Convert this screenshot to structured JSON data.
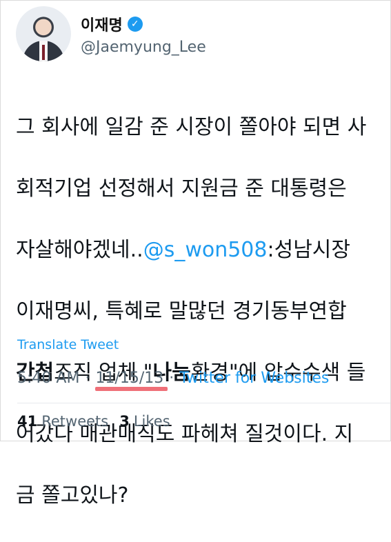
{
  "tweet": {
    "author": {
      "display_name": "이재명",
      "handle": "@Jaemyung_Lee",
      "verified_icon": "verified-badge-icon"
    },
    "text": {
      "line1": "그 회사에 일감 준 시장이 쫄아야 되면 사",
      "line2": "회적기업 선정해서 지원금 준 대통령은",
      "line3_prefix": "자살해야겠네..",
      "mention": "@s_won508",
      "line3_suffix": ":성남시장",
      "line4": "이재명씨, 특혜로 말많던 경기동부연합",
      "line5_bold1": "간첩",
      "line5_mid1": "조직 업체 \"",
      "line5_bold2": "나눔",
      "line5_mid2": "환경\"에 압수수색 들",
      "line6": "어갔다 매관매직도 파헤쳐 질것이다. 지",
      "line7": "금 쫄고있나?"
    },
    "translate_link": "Translate Tweet",
    "meta": {
      "time": "5:40 AM",
      "separator": "·",
      "date": "11/15/13",
      "source": "Twitter for Websites"
    },
    "stats": {
      "retweets_count": "41",
      "retweets_label": "Retweets",
      "likes_count": "3",
      "likes_label": "Likes"
    },
    "colors": {
      "link": "#1d9bf0",
      "muted": "#536471",
      "highlight_underline": "#ef6f78"
    }
  }
}
